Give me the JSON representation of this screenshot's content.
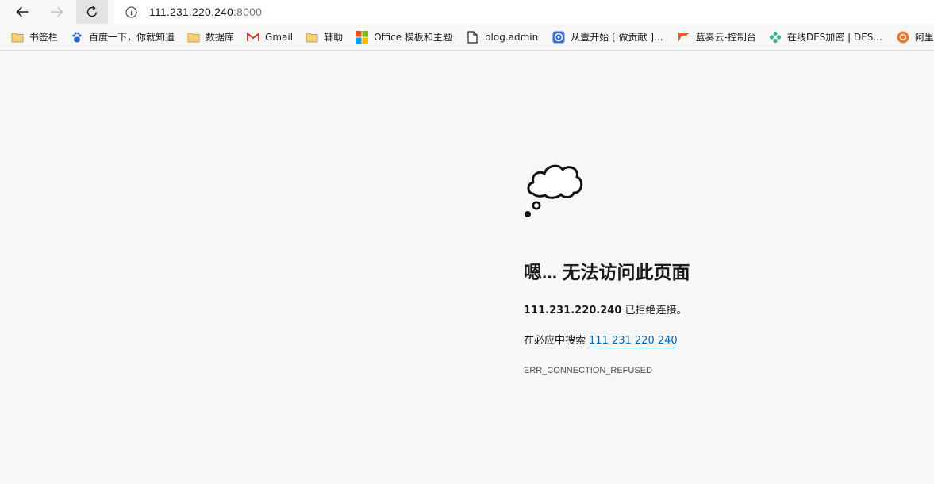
{
  "address_bar": {
    "host": "111.231.220.240",
    "port": ":8000"
  },
  "bookmarks": [
    {
      "label": "书签栏",
      "icon": "folder-icon"
    },
    {
      "label": "百度一下，你就知道",
      "icon": "baidu-paw-icon"
    },
    {
      "label": "数据库",
      "icon": "folder-icon"
    },
    {
      "label": "Gmail",
      "icon": "gmail-icon"
    },
    {
      "label": "辅助",
      "icon": "folder-icon"
    },
    {
      "label": "Office 模板和主题",
      "icon": "microsoft-logo-icon"
    },
    {
      "label": "blog.admin",
      "icon": "page-icon"
    },
    {
      "label": "从壹开始 [ 做贡献 ]...",
      "icon": "github-like-icon"
    },
    {
      "label": "蓝奏云-控制台",
      "icon": "flag-icon"
    },
    {
      "label": "在线DES加密 | DES...",
      "icon": "gear-flower-icon"
    },
    {
      "label": "阿里妈妈",
      "icon": "alimama-icon"
    }
  ],
  "error": {
    "title": "嗯... 无法访问此页面",
    "host": "111.231.220.240",
    "refused_text": " 已拒绝连接。",
    "search_prefix": "在必应中搜索",
    "search_link": "111 231 220 240",
    "code": "ERR_CONNECTION_REFUSED"
  },
  "colors": {
    "link": "#0067b8",
    "folder": "#f0c043"
  }
}
